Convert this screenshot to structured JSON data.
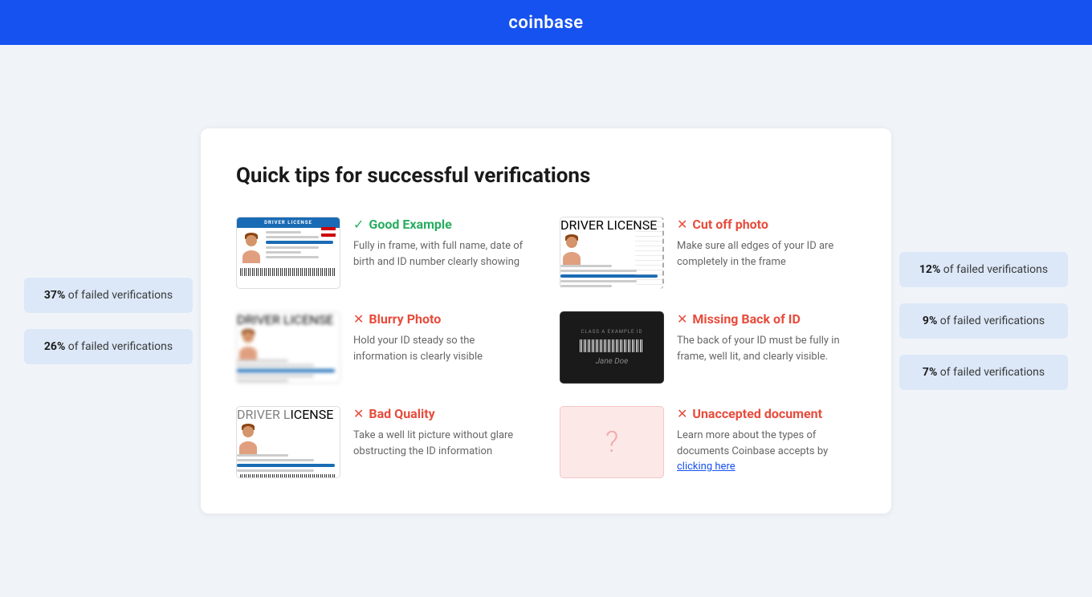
{
  "header": {
    "logo": "coinbase"
  },
  "page": {
    "title": "Quick tips for successful verifications"
  },
  "left_stats": [
    {
      "percent": "37%",
      "label": "of failed verifications"
    },
    {
      "percent": "26%",
      "label": "of failed verifications"
    }
  ],
  "right_stats": [
    {
      "percent": "12%",
      "label": "of failed verifications"
    },
    {
      "percent": "9%",
      "label": "of failed verifications"
    },
    {
      "percent": "7%",
      "label": "of failed verifications"
    }
  ],
  "tips": [
    {
      "id": "good-example",
      "type": "good",
      "icon_label": "check",
      "title": "Good Example",
      "description": "Fully in frame, with full name, date of birth and ID number clearly showing"
    },
    {
      "id": "cut-off-photo",
      "type": "bad",
      "icon_label": "x",
      "title": "Cut off photo",
      "description": "Make sure all edges of your ID are completely in the frame"
    },
    {
      "id": "blurry-photo",
      "type": "bad",
      "icon_label": "x",
      "title": "Blurry Photo",
      "description": "Hold your ID steady so the information is clearly visible"
    },
    {
      "id": "missing-back",
      "type": "bad",
      "icon_label": "x",
      "title": "Missing Back of ID",
      "description": "The back of your ID must be fully in frame, well lit, and clearly visible."
    },
    {
      "id": "bad-quality",
      "type": "bad",
      "icon_label": "x",
      "title": "Bad Quality",
      "description": "Take a well lit picture without glare obstructing the ID information"
    },
    {
      "id": "unaccepted-document",
      "type": "bad",
      "icon_label": "x",
      "title": "Unaccepted document",
      "description": "Learn more about the types of documents Coinbase accepts by ",
      "link_text": "clicking here",
      "link_href": "#"
    }
  ]
}
